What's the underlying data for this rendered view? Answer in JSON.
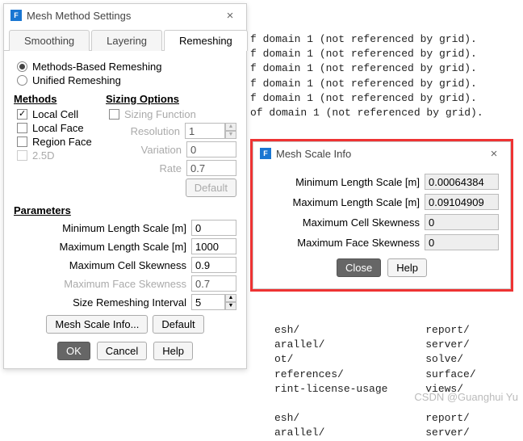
{
  "mainWindow": {
    "title": "Mesh Method Settings",
    "tabs": [
      "Smoothing",
      "Layering",
      "Remeshing"
    ],
    "activeTab": 2,
    "radios": {
      "methodsBased": "Methods-Based Remeshing",
      "unified": "Unified Remeshing"
    },
    "methods": {
      "title": "Methods",
      "localCell": "Local Cell",
      "localFace": "Local Face",
      "regionFace": "Region Face",
      "twoPointFiveD": "2.5D"
    },
    "sizing": {
      "title": "Sizing Options",
      "sizingFunction": "Sizing Function",
      "resolution": {
        "label": "Resolution",
        "value": "1"
      },
      "variation": {
        "label": "Variation",
        "value": "0"
      },
      "rate": {
        "label": "Rate",
        "value": "0.7"
      },
      "default": "Default"
    },
    "parameters": {
      "title": "Parameters",
      "minLength": {
        "label": "Minimum Length Scale [m]",
        "value": "0"
      },
      "maxLength": {
        "label": "Maximum Length Scale [m]",
        "value": "1000"
      },
      "maxCellSkew": {
        "label": "Maximum Cell Skewness",
        "value": "0.9"
      },
      "maxFaceSkew": {
        "label": "Maximum Face Skewness",
        "value": "0.7"
      },
      "sizeInterval": {
        "label": "Size Remeshing Interval",
        "value": "5"
      },
      "meshScaleInfo": "Mesh Scale Info...",
      "default": "Default"
    },
    "footer": {
      "ok": "OK",
      "cancel": "Cancel",
      "help": "Help"
    }
  },
  "console1": "f domain 1 (not referenced by grid).\nf domain 1 (not referenced by grid).\nf domain 1 (not referenced by grid).\nf domain 1 (not referenced by grid).\nf domain 1 (not referenced by grid).\nof domain 1 (not referenced by grid).",
  "console2": "esh/                    report/\narallel/                server/\not/                     solve/\nreferences/             surface/\nrint-license-usage      views/\n\nesh/                    report/\narallel/                server/",
  "meshScale": {
    "title": "Mesh Scale Info",
    "minLength": {
      "label": "Minimum Length Scale [m]",
      "value": "0.00064384"
    },
    "maxLength": {
      "label": "Maximum Length Scale [m]",
      "value": "0.09104909"
    },
    "maxCellSkew": {
      "label": "Maximum Cell Skewness",
      "value": "0"
    },
    "maxFaceSkew": {
      "label": "Maximum Face Skewness",
      "value": "0"
    },
    "close": "Close",
    "help": "Help"
  },
  "watermark": "CSDN @Guanghui Yu"
}
